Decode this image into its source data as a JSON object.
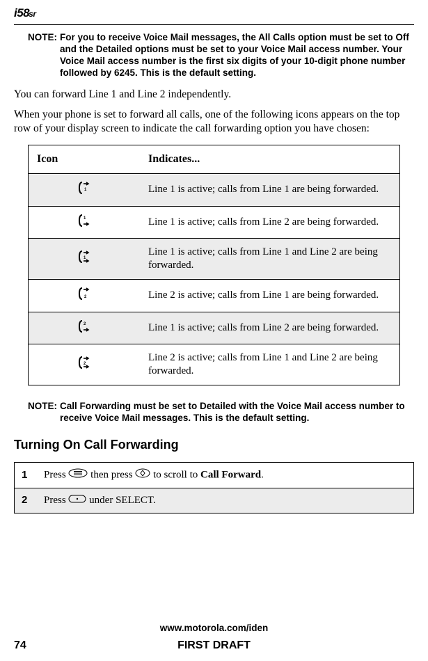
{
  "header": {
    "model_prefix": "i58",
    "model_suffix": "sr"
  },
  "note1": {
    "label": "NOTE:",
    "text": "For you to receive Voice Mail messages, the All Calls option must be set to Off and the Detailed options must be set to your Voice Mail access number. Your Voice Mail access number is the first six digits of your 10-digit phone number followed by 6245. This is the default setting."
  },
  "para1": "You can forward Line 1 and Line 2 independently.",
  "para2": "When your phone is set to forward all calls, one of the following icons appears on the top row of your display screen to indicate the call forwarding option you have chosen:",
  "iconTable": {
    "headers": {
      "col1": "Icon",
      "col2": "Indicates..."
    },
    "rows": [
      {
        "shade": true,
        "desc": "Line 1 is active; calls from Line 1 are being forwarded."
      },
      {
        "shade": false,
        "desc": "Line 1 is active; calls from Line 2 are being forwarded."
      },
      {
        "shade": true,
        "desc": "Line 1 is active; calls from Line 1 and Line 2 are being forwarded."
      },
      {
        "shade": false,
        "desc": "Line 2 is active; calls from Line 1 are being forwarded."
      },
      {
        "shade": true,
        "desc": "Line 1 is active; calls from Line 2 are being forwarded."
      },
      {
        "shade": false,
        "desc": "Line 2 is active; calls from Line 1 and Line 2 are being forwarded."
      }
    ]
  },
  "note2": {
    "label": "NOTE:",
    "text": "Call Forwarding must be set to Detailed with the Voice Mail access number to receive Voice Mail messages. This is the default setting."
  },
  "sectionHeading": "Turning On Call Forwarding",
  "steps": [
    {
      "num": "1",
      "before": "Press ",
      "mid": " then press ",
      "after": " to scroll to ",
      "bold": "Call Forward",
      "end": "."
    },
    {
      "num": "2",
      "before": "Press ",
      "after": " under SELECT."
    }
  ],
  "footer": {
    "url": "www.motorola.com/iden",
    "page": "74",
    "draft": "FIRST DRAFT"
  }
}
